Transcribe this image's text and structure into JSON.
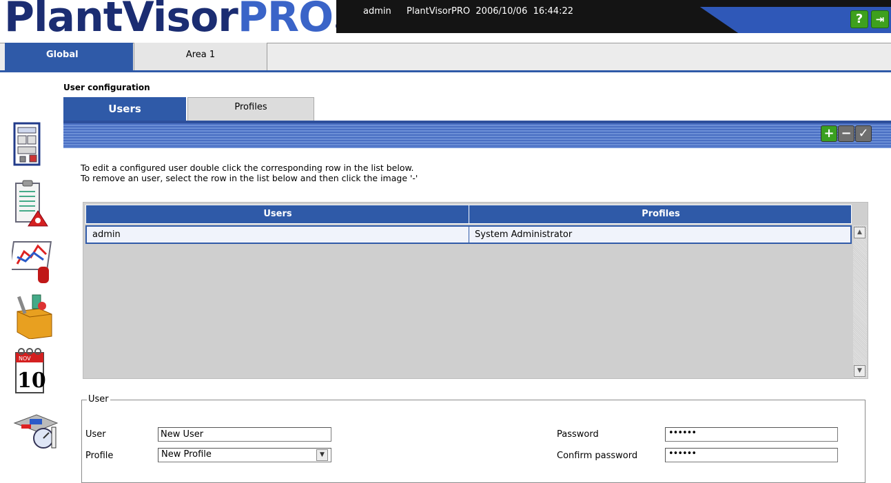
{
  "header": {
    "logo_main": "PlantVisor",
    "logo_pro": "PRO",
    "logo_reg": "®",
    "user": "admin",
    "info": "PlantVisorPRO  2006/10/06  16:44:22",
    "help_icon": "?",
    "exit_icon": "⇥"
  },
  "top_tabs": [
    {
      "label": "Global",
      "active": true
    },
    {
      "label": "Area 1",
      "active": false
    }
  ],
  "sidebar": {
    "icons": [
      "device-map-icon",
      "alarm-list-icon",
      "graph-icon",
      "tools-box-icon",
      "calendar-icon",
      "plant-layout-icon"
    ],
    "calendar_month": "NOV",
    "calendar_day": "10"
  },
  "page": {
    "title": "User configuration",
    "tabs": [
      {
        "label": "Users",
        "active": true
      },
      {
        "label": "Profiles",
        "active": false
      }
    ],
    "toolbar": {
      "add": "+",
      "remove": "−",
      "confirm": "✓"
    },
    "instructions": [
      "To edit a configured user double click the corresponding row in the list below.",
      "To remove an user, select the row in the list below and then click the image '-'"
    ]
  },
  "table": {
    "columns": [
      "Users",
      "Profiles"
    ],
    "rows": [
      {
        "user": "admin",
        "profile": "System Administrator"
      }
    ]
  },
  "user_form": {
    "legend": "User",
    "user_label": "User",
    "user_value": "New User",
    "profile_label": "Profile",
    "profile_value": "New Profile",
    "password_label": "Password",
    "password_value": "••••••",
    "confirm_label": "Confirm password",
    "confirm_value": "••••••"
  },
  "colors": {
    "accent_blue": "#2f5aa8",
    "header_dark": "#141414",
    "green_button": "#3aa020"
  }
}
